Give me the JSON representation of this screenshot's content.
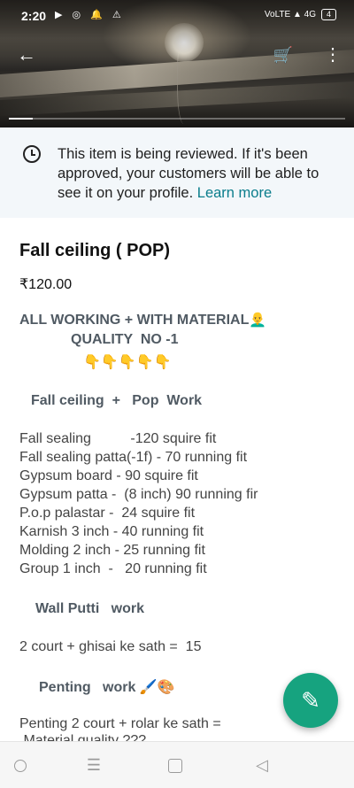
{
  "status_bar": {
    "time": "2:20",
    "notification_icons": "▶ ◎ 🔔 ⚠",
    "network": "VoLTE ▲ 4G",
    "battery": "4"
  },
  "hero": {
    "image_progress": 0.07
  },
  "appbar": {
    "back_icon": "←",
    "cart_icon": "🛒",
    "more_icon": "⋮"
  },
  "notice": {
    "text": "This item is being reviewed. If it's been approved, your customers will be able to see it on your profile.",
    "link": "Learn more"
  },
  "product": {
    "title": "Fall ceiling ( POP)",
    "price": "₹120.00"
  },
  "description": {
    "headline1": "ALL WORKING + WITH MATERIAL👨‍🦲",
    "headline2": "QUALITY  NO -1",
    "pointers": "👇👇👇👇👇",
    "section1": "Fall ceiling  +   Pop  Work",
    "lines": [
      "Fall sealing          -120 squire fit",
      "Fall sealing patta(-1f) - 70 running fit",
      "Gypsum board - 90 squire fit",
      "Gypsum patta -  (8 inch) 90 running fir",
      "P.o.p palastar -  24 squire fit",
      "Karnish 3 inch - 40 running fit",
      "Molding 2 inch - 25 running fit",
      "Group 1 inch  -   20 running fit"
    ],
    "section2": "Wall Putti   work",
    "putti_line": "2 court + ghisai ke sath =  15",
    "section3": "Penting   work 🖌️🎨",
    "penting_line": "Penting 2 court + rolar ke sath =",
    "material_line": " Material quality ???"
  },
  "fab": {
    "icon": "✎"
  },
  "navbar": {
    "menu_icon": "☰",
    "back_icon": "◁"
  }
}
